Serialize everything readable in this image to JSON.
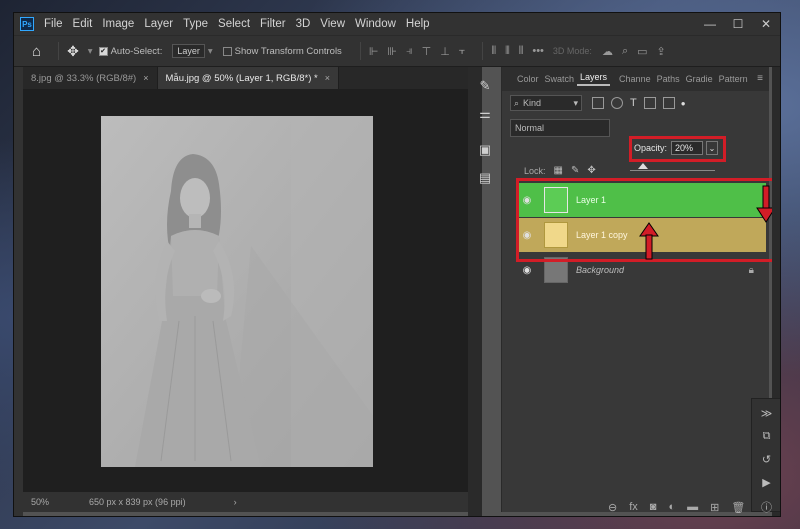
{
  "menu": {
    "items": [
      "File",
      "Edit",
      "Image",
      "Layer",
      "Type",
      "Select",
      "Filter",
      "3D",
      "View",
      "Window",
      "Help"
    ],
    "logo": "Ps"
  },
  "window_controls": {
    "minimize": "—",
    "maximize": "☐",
    "close": "✕"
  },
  "options": {
    "auto_select_label": "Auto-Select:",
    "auto_select_value": "Layer",
    "show_transform_label": "Show Transform Controls",
    "mode_3d": "3D Mode:"
  },
  "tabs": [
    {
      "label": "8.jpg @ 33.3% (RGB/8#)",
      "close": "×"
    },
    {
      "label": "Mẫu.jpg @ 50% (Layer 1, RGB/8*) *",
      "close": "×"
    }
  ],
  "status": {
    "zoom": "50%",
    "doc_info": "650 px x 839 px (96 ppi)",
    "chevron": "›"
  },
  "panel": {
    "tabs": [
      "Color",
      "Swatch",
      "Layers",
      "Channe",
      "Paths",
      "Gradie",
      "Pattern"
    ],
    "active_tab": "Layers",
    "kind_label": "Kind",
    "blend_mode": "Normal",
    "opacity_label": "Opacity:",
    "opacity_value": "20%",
    "lock_label": "Lock:",
    "layers": [
      {
        "name": "Layer 1",
        "color": "#4fbf48"
      },
      {
        "name": "Layer 1 copy",
        "color": "#c0a85a"
      },
      {
        "name": "Background",
        "color": "#383838"
      }
    ]
  },
  "colors": {
    "highlight_red": "#d21d27",
    "layer1_green": "#4fbf48",
    "copy_gold": "#c0a85a"
  },
  "icons": {
    "home": "⌂",
    "move": "✥",
    "search": "⌕",
    "share": "⇪",
    "more": "•••"
  }
}
